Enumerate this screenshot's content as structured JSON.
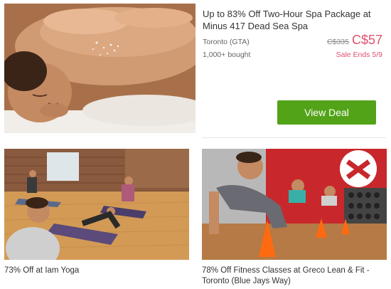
{
  "featured": {
    "title": "Up to 83% Off Two-Hour Spa Package at Minus 417 Dead Sea Spa",
    "location": "Toronto (GTA)",
    "bought": "1,000+ bought",
    "original_price": "C$335",
    "price": "C$57",
    "sale_ends": "Sale Ends 5/9",
    "cta_label": "View Deal",
    "image_icon": "spa-massage-photo"
  },
  "deals": [
    {
      "title": "73% Off at Iam Yoga",
      "image_icon": "yoga-class-photo"
    },
    {
      "title": "78% Off Fitness Classes at Greco Lean & Fit - Toronto (Blue Jays Way)",
      "image_icon": "fitness-class-photo"
    }
  ],
  "colors": {
    "accent_green": "#53a318",
    "price_pink": "#e35070",
    "text_dark": "#333333",
    "text_muted": "#666666"
  }
}
